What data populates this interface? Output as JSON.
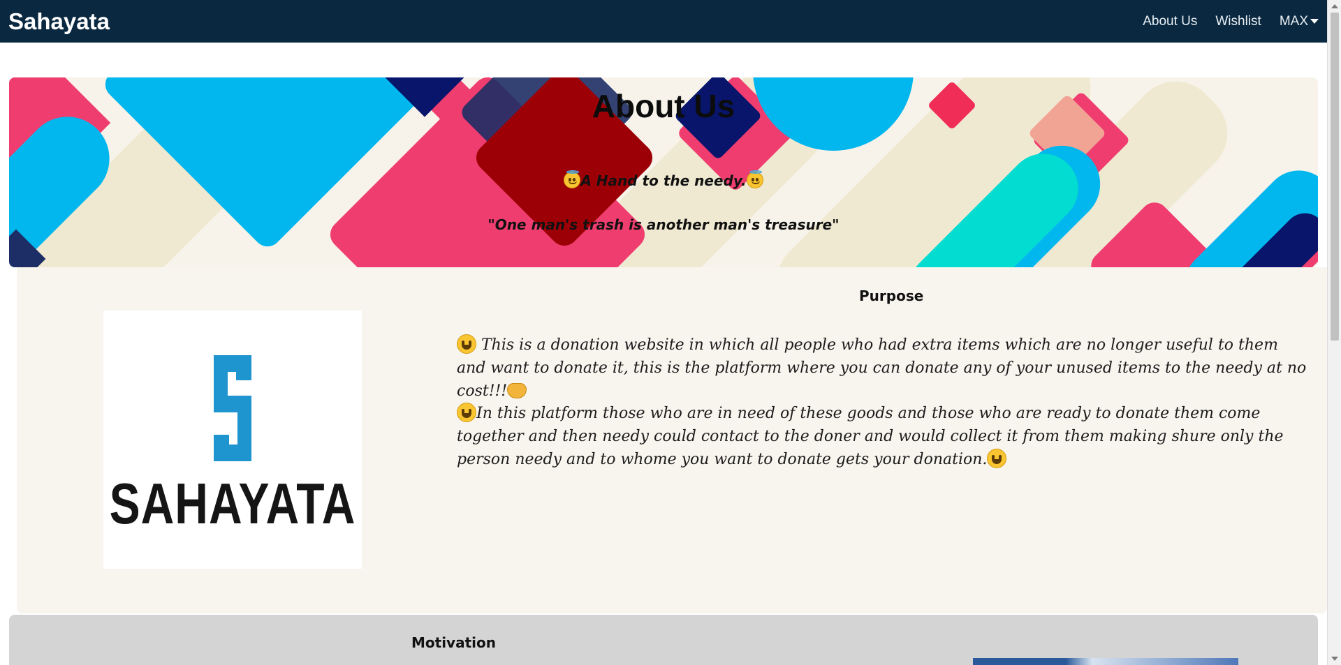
{
  "navbar": {
    "brand": "Sahayata",
    "links": [
      {
        "label": "About Us"
      },
      {
        "label": "Wishlist"
      },
      {
        "label": "MAX"
      }
    ]
  },
  "banner": {
    "title": "About Us",
    "tagline": "A Hand to the needy.",
    "quote": "\"One man's trash is another man's treasure\""
  },
  "purpose": {
    "heading": "Purpose",
    "logo_text": "SAHAYATA",
    "paragraphs": [
      " This is a donation website in which all people who had extra items which are no longer useful to them and want to donate it, this is the platform where you can donate any of your unused items to the needy at no cost!!!",
      "In this platform those who are in need of these goods and those who are ready to donate them come together and then needy could contact to the doner and would collect it from them making shure only the person needy and to whome you want to donate gets your donation."
    ]
  },
  "motivation": {
    "heading": "Motivation"
  },
  "colors": {
    "navbar": "#0a2941",
    "purpose_bg": "#f8f5ef",
    "motivation_bg": "#d4d4d4",
    "logo_blue": "#1f95d0"
  }
}
